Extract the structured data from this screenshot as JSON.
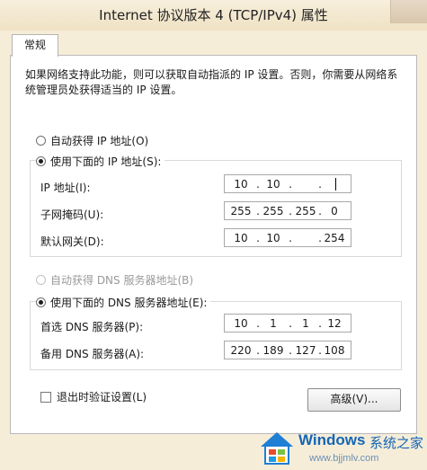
{
  "window": {
    "title": "Internet 协议版本 4 (TCP/IPv4) 属性"
  },
  "tabs": [
    {
      "label": "常规"
    }
  ],
  "description": "如果网络支持此功能，则可以获取自动指派的 IP 设置。否则，你需要从网络系统管理员处获得适当的 IP 设置。",
  "ip_section": {
    "auto_label": "自动获得 IP 地址(O)",
    "manual_label": "使用下面的 IP 地址(S):",
    "ip_label": "IP 地址(I):",
    "ip": [
      "10",
      "10",
      "",
      ""
    ],
    "mask_label": "子网掩码(U):",
    "mask": [
      "255",
      "255",
      "255",
      "0"
    ],
    "gateway_label": "默认网关(D):",
    "gateway": [
      "10",
      "10",
      "",
      "254"
    ]
  },
  "dns_section": {
    "auto_label": "自动获得 DNS 服务器地址(B)",
    "manual_label": "使用下面的 DNS 服务器地址(E):",
    "preferred_label": "首选 DNS 服务器(P):",
    "preferred": [
      "10",
      "1",
      "1",
      "12"
    ],
    "alternate_label": "备用 DNS 服务器(A):",
    "alternate": [
      "220",
      "189",
      "127",
      "108"
    ]
  },
  "validate_label": "退出时验证设置(L)",
  "advanced_label": "高级(V)...",
  "watermark": {
    "main": "Windows",
    "cn": "系统之家",
    "url": "www.bjjmlv.com"
  },
  "colors": {
    "window_frame": "#f6edd9",
    "panel": "#ffffff",
    "watermark_blue": "#1466b5"
  }
}
